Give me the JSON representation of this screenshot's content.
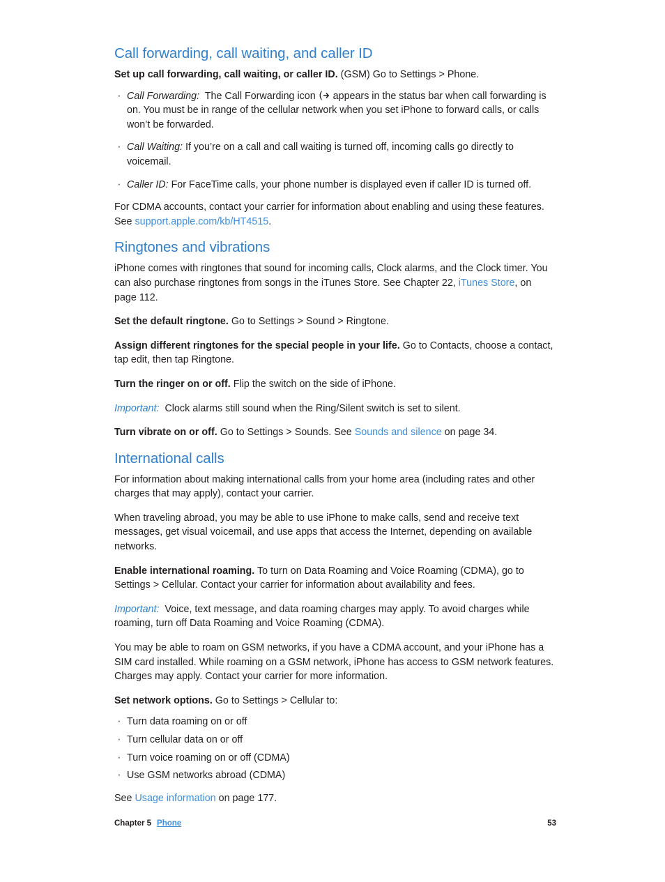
{
  "page": {
    "heading_color": "#3180cc",
    "link_color": "#3e8ede",
    "body_color": "#231f20"
  },
  "sections": {
    "call_forwarding": {
      "heading": "Call forwarding, call waiting, and caller ID",
      "intro_bold": "Set up call forwarding, call waiting, or caller ID.",
      "intro_rest": "(GSM) Go to Settings > Phone.",
      "bullets": [
        {
          "term": "Call Forwarding:",
          "text_before_icon": "The Call Forwarding icon",
          "icon": "call-forwarding-icon",
          "text_after_icon": "appears in the status bar when call forwarding is on. You must be in range of the cellular network when you set iPhone to forward calls, or calls won’t be forwarded."
        },
        {
          "term": "Call Waiting:",
          "text": "If you’re on a call and call waiting is turned off, incoming calls go directly to voicemail."
        },
        {
          "term": "Caller ID:",
          "text": "For FaceTime calls, your phone number is displayed even if caller ID is turned off."
        }
      ],
      "closing_before_link": "For CDMA accounts, contact your carrier for information about enabling and using these features. See ",
      "closing_link": "support.apple.com/kb/HT4515",
      "closing_after_link": "."
    },
    "ringtones": {
      "heading": "Ringtones and vibrations",
      "intro_before_link": "iPhone comes with ringtones that sound for incoming calls, Clock alarms, and the Clock timer. You can also purchase ringtones from songs in the iTunes Store. See Chapter 22, ",
      "intro_link": "iTunes Store",
      "intro_after_link": ", on page 112.",
      "paragraphs": [
        {
          "bold": "Set the default ringtone.",
          "rest": "Go to Settings > Sound > Ringtone."
        },
        {
          "bold": "Assign different ringtones for the special people in your life.",
          "rest": "Go to Contacts, choose a contact, tap edit, then tap Ringtone."
        },
        {
          "bold": "Turn the ringer on or off.",
          "rest": "Flip the switch on the side of iPhone."
        }
      ],
      "important_label": "Important:",
      "important_text": "Clock alarms still sound when the Ring/Silent switch is set to silent.",
      "vibrate_bold": "Turn vibrate on or off.",
      "vibrate_before_link": "Go to Settings > Sounds. See ",
      "vibrate_link": "Sounds and silence",
      "vibrate_after_link": " on page 34."
    },
    "international": {
      "heading": "International calls",
      "para1": "For information about making international calls from your home area (including rates and other charges that may apply), contact your carrier.",
      "para2": "When traveling abroad, you may be able to use iPhone to make calls, send and receive text messages, get visual voicemail, and use apps that access the Internet, depending on available networks.",
      "roaming_bold": "Enable international roaming.",
      "roaming_rest": "To turn on Data Roaming and Voice Roaming (CDMA), go to Settings > Cellular. Contact your carrier for information about availability and fees.",
      "important_label": "Important:",
      "important_text": "Voice, text message, and data roaming charges may apply. To avoid charges while roaming, turn off Data Roaming and Voice Roaming (CDMA).",
      "para3": "You may be able to roam on GSM networks, if you have a CDMA account, and your iPhone has a SIM card installed. While roaming on a GSM network, iPhone has access to GSM network features. Charges may apply. Contact your carrier for more information.",
      "network_bold": "Set network options.",
      "network_rest": "Go to Settings > Cellular to:",
      "options": [
        "Turn data roaming on or off",
        "Turn cellular data on or off",
        "Turn voice roaming on or off (CDMA)",
        "Use GSM networks abroad (CDMA)"
      ],
      "see_before_link": "See ",
      "see_link": "Usage information",
      "see_after_link": " on page 177."
    }
  },
  "footer": {
    "chapter": "Chapter  5",
    "chapter_link": "Phone",
    "page_number": "53"
  }
}
